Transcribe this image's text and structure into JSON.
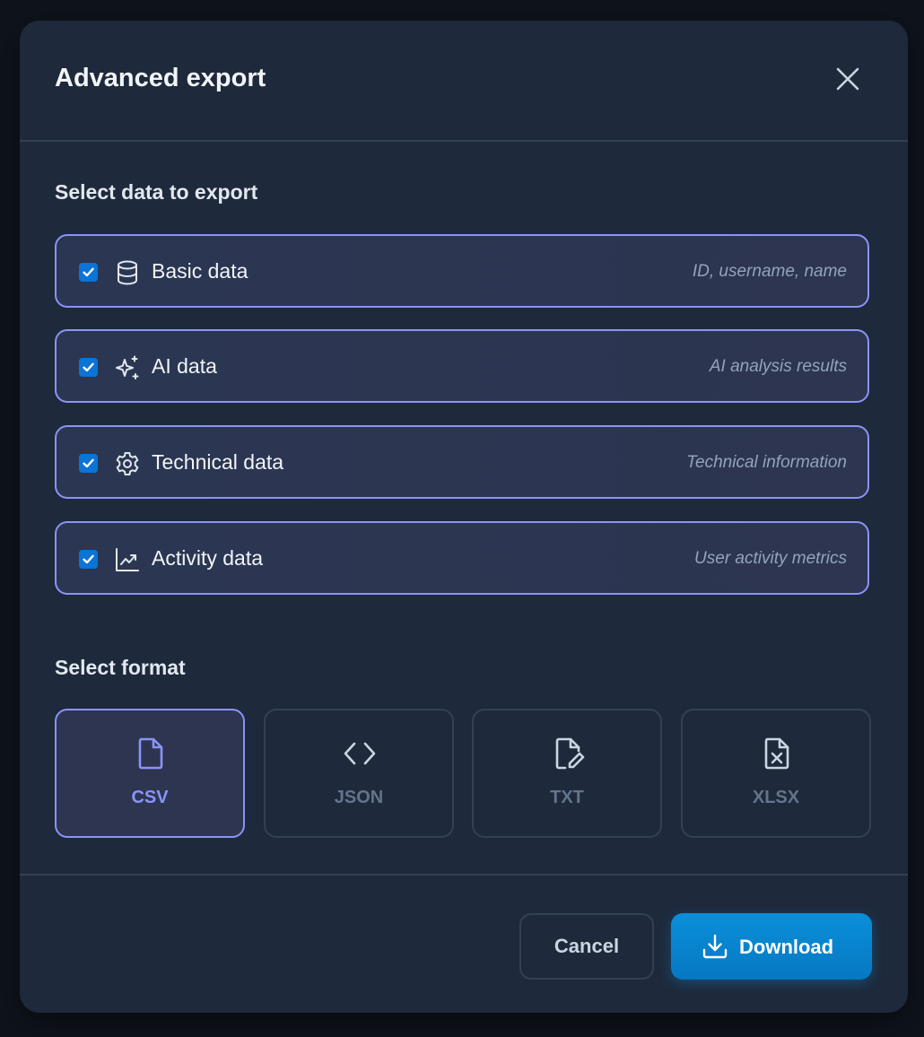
{
  "dialog": {
    "title": "Advanced export",
    "close_icon": "close-icon"
  },
  "data_section": {
    "title": "Select data to export",
    "options": [
      {
        "label": "Basic data",
        "description": "ID, username, name",
        "icon": "database-icon",
        "checked": true
      },
      {
        "label": "AI data",
        "description": "AI analysis results",
        "icon": "sparkles-icon",
        "checked": true
      },
      {
        "label": "Technical data",
        "description": "Technical information",
        "icon": "gear-icon",
        "checked": true
      },
      {
        "label": "Activity data",
        "description": "User activity metrics",
        "icon": "trending-chart-icon",
        "checked": true
      }
    ]
  },
  "format_section": {
    "title": "Select format",
    "formats": [
      {
        "label": "CSV",
        "icon": "file-icon",
        "selected": true
      },
      {
        "label": "JSON",
        "icon": "code-brackets-icon",
        "selected": false
      },
      {
        "label": "TXT",
        "icon": "file-edit-icon",
        "selected": false
      },
      {
        "label": "XLSX",
        "icon": "file-spreadsheet-icon",
        "selected": false
      }
    ]
  },
  "footer": {
    "cancel_label": "Cancel",
    "download_label": "Download",
    "download_icon": "download-icon"
  },
  "colors": {
    "accent": "#8b93f8",
    "primary_button": "#0b8fd9",
    "checkbox": "#0b74d6",
    "modal_bg": "#1e293b"
  }
}
